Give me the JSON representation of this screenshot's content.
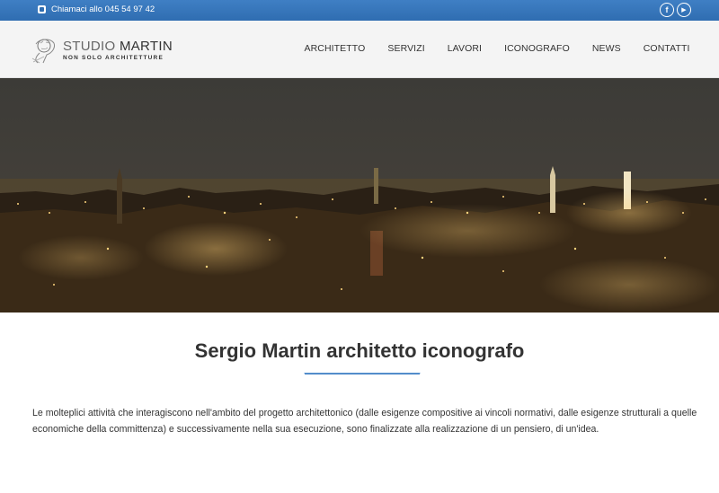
{
  "topbar": {
    "phone_text": "Chiamaci allo 045 54 97 42",
    "social": [
      {
        "icon": "facebook-icon",
        "glyph": "f"
      },
      {
        "icon": "youtube-icon",
        "glyph": "▶"
      }
    ]
  },
  "header": {
    "logo_line1_light": "STUDIO ",
    "logo_line1_bold": "MARTIN",
    "logo_line2": "NON SOLO ARCHITETTURE",
    "nav": [
      "ARCHITETTO",
      "SERVIZI",
      "LAVORI",
      "ICONOGRAFO",
      "NEWS",
      "CONTATTI"
    ]
  },
  "main": {
    "headline_name": "Sergio Martin",
    "headline_rest": " architetto iconografo",
    "paragraph": "Le molteplici attività che interagiscono nell'ambito del progetto architettonico (dalle esigenze compositive ai vincoli normativi, dalle esigenze strutturali a quelle economiche della committenza) e successivamente nella sua esecuzione, sono finalizzate alla realizzazione di un pensiero, di un'idea."
  },
  "colors": {
    "accent": "#3f7fc4",
    "header_bg": "#f4f4f4",
    "text": "#333333"
  }
}
